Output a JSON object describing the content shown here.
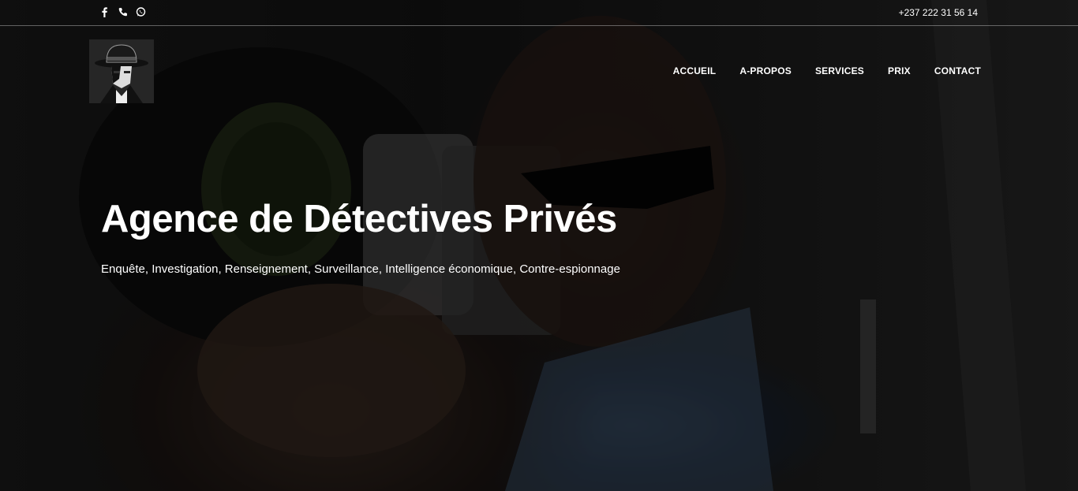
{
  "topbar": {
    "social_icons": [
      "facebook-icon",
      "phone-icon",
      "whatsapp-icon"
    ],
    "phone": "+237 222 31 56 14"
  },
  "header": {
    "logo_icon": "detective-logo",
    "nav": [
      "ACCUEIL",
      "A-PROPOS",
      "SERVICES",
      "PRIX",
      "CONTACT"
    ]
  },
  "hero": {
    "title": "Agence de Détectives Privés",
    "subtitle": "Enquête, Investigation, Renseignement, Surveillance, Intelligence économique, Contre-espionnage"
  },
  "colors": {
    "text": "#ffffff",
    "background": "#111111"
  }
}
